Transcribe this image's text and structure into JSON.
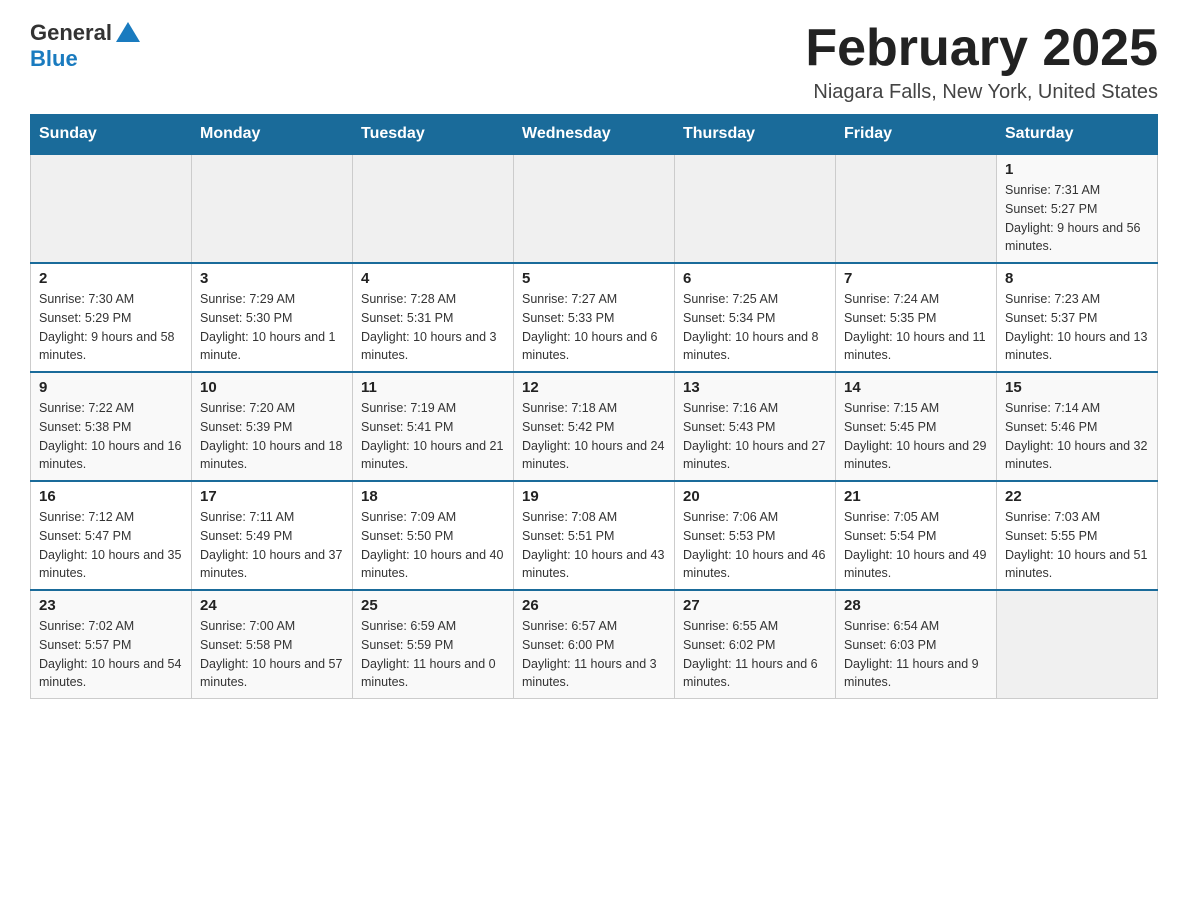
{
  "header": {
    "logo_general": "General",
    "logo_blue": "Blue",
    "month_title": "February 2025",
    "location": "Niagara Falls, New York, United States"
  },
  "days_of_week": [
    "Sunday",
    "Monday",
    "Tuesday",
    "Wednesday",
    "Thursday",
    "Friday",
    "Saturday"
  ],
  "weeks": [
    [
      {
        "day": "",
        "sunrise": "",
        "sunset": "",
        "daylight": "",
        "empty": true
      },
      {
        "day": "",
        "sunrise": "",
        "sunset": "",
        "daylight": "",
        "empty": true
      },
      {
        "day": "",
        "sunrise": "",
        "sunset": "",
        "daylight": "",
        "empty": true
      },
      {
        "day": "",
        "sunrise": "",
        "sunset": "",
        "daylight": "",
        "empty": true
      },
      {
        "day": "",
        "sunrise": "",
        "sunset": "",
        "daylight": "",
        "empty": true
      },
      {
        "day": "",
        "sunrise": "",
        "sunset": "",
        "daylight": "",
        "empty": true
      },
      {
        "day": "1",
        "sunrise": "Sunrise: 7:31 AM",
        "sunset": "Sunset: 5:27 PM",
        "daylight": "Daylight: 9 hours and 56 minutes.",
        "empty": false
      }
    ],
    [
      {
        "day": "2",
        "sunrise": "Sunrise: 7:30 AM",
        "sunset": "Sunset: 5:29 PM",
        "daylight": "Daylight: 9 hours and 58 minutes.",
        "empty": false
      },
      {
        "day": "3",
        "sunrise": "Sunrise: 7:29 AM",
        "sunset": "Sunset: 5:30 PM",
        "daylight": "Daylight: 10 hours and 1 minute.",
        "empty": false
      },
      {
        "day": "4",
        "sunrise": "Sunrise: 7:28 AM",
        "sunset": "Sunset: 5:31 PM",
        "daylight": "Daylight: 10 hours and 3 minutes.",
        "empty": false
      },
      {
        "day": "5",
        "sunrise": "Sunrise: 7:27 AM",
        "sunset": "Sunset: 5:33 PM",
        "daylight": "Daylight: 10 hours and 6 minutes.",
        "empty": false
      },
      {
        "day": "6",
        "sunrise": "Sunrise: 7:25 AM",
        "sunset": "Sunset: 5:34 PM",
        "daylight": "Daylight: 10 hours and 8 minutes.",
        "empty": false
      },
      {
        "day": "7",
        "sunrise": "Sunrise: 7:24 AM",
        "sunset": "Sunset: 5:35 PM",
        "daylight": "Daylight: 10 hours and 11 minutes.",
        "empty": false
      },
      {
        "day": "8",
        "sunrise": "Sunrise: 7:23 AM",
        "sunset": "Sunset: 5:37 PM",
        "daylight": "Daylight: 10 hours and 13 minutes.",
        "empty": false
      }
    ],
    [
      {
        "day": "9",
        "sunrise": "Sunrise: 7:22 AM",
        "sunset": "Sunset: 5:38 PM",
        "daylight": "Daylight: 10 hours and 16 minutes.",
        "empty": false
      },
      {
        "day": "10",
        "sunrise": "Sunrise: 7:20 AM",
        "sunset": "Sunset: 5:39 PM",
        "daylight": "Daylight: 10 hours and 18 minutes.",
        "empty": false
      },
      {
        "day": "11",
        "sunrise": "Sunrise: 7:19 AM",
        "sunset": "Sunset: 5:41 PM",
        "daylight": "Daylight: 10 hours and 21 minutes.",
        "empty": false
      },
      {
        "day": "12",
        "sunrise": "Sunrise: 7:18 AM",
        "sunset": "Sunset: 5:42 PM",
        "daylight": "Daylight: 10 hours and 24 minutes.",
        "empty": false
      },
      {
        "day": "13",
        "sunrise": "Sunrise: 7:16 AM",
        "sunset": "Sunset: 5:43 PM",
        "daylight": "Daylight: 10 hours and 27 minutes.",
        "empty": false
      },
      {
        "day": "14",
        "sunrise": "Sunrise: 7:15 AM",
        "sunset": "Sunset: 5:45 PM",
        "daylight": "Daylight: 10 hours and 29 minutes.",
        "empty": false
      },
      {
        "day": "15",
        "sunrise": "Sunrise: 7:14 AM",
        "sunset": "Sunset: 5:46 PM",
        "daylight": "Daylight: 10 hours and 32 minutes.",
        "empty": false
      }
    ],
    [
      {
        "day": "16",
        "sunrise": "Sunrise: 7:12 AM",
        "sunset": "Sunset: 5:47 PM",
        "daylight": "Daylight: 10 hours and 35 minutes.",
        "empty": false
      },
      {
        "day": "17",
        "sunrise": "Sunrise: 7:11 AM",
        "sunset": "Sunset: 5:49 PM",
        "daylight": "Daylight: 10 hours and 37 minutes.",
        "empty": false
      },
      {
        "day": "18",
        "sunrise": "Sunrise: 7:09 AM",
        "sunset": "Sunset: 5:50 PM",
        "daylight": "Daylight: 10 hours and 40 minutes.",
        "empty": false
      },
      {
        "day": "19",
        "sunrise": "Sunrise: 7:08 AM",
        "sunset": "Sunset: 5:51 PM",
        "daylight": "Daylight: 10 hours and 43 minutes.",
        "empty": false
      },
      {
        "day": "20",
        "sunrise": "Sunrise: 7:06 AM",
        "sunset": "Sunset: 5:53 PM",
        "daylight": "Daylight: 10 hours and 46 minutes.",
        "empty": false
      },
      {
        "day": "21",
        "sunrise": "Sunrise: 7:05 AM",
        "sunset": "Sunset: 5:54 PM",
        "daylight": "Daylight: 10 hours and 49 minutes.",
        "empty": false
      },
      {
        "day": "22",
        "sunrise": "Sunrise: 7:03 AM",
        "sunset": "Sunset: 5:55 PM",
        "daylight": "Daylight: 10 hours and 51 minutes.",
        "empty": false
      }
    ],
    [
      {
        "day": "23",
        "sunrise": "Sunrise: 7:02 AM",
        "sunset": "Sunset: 5:57 PM",
        "daylight": "Daylight: 10 hours and 54 minutes.",
        "empty": false
      },
      {
        "day": "24",
        "sunrise": "Sunrise: 7:00 AM",
        "sunset": "Sunset: 5:58 PM",
        "daylight": "Daylight: 10 hours and 57 minutes.",
        "empty": false
      },
      {
        "day": "25",
        "sunrise": "Sunrise: 6:59 AM",
        "sunset": "Sunset: 5:59 PM",
        "daylight": "Daylight: 11 hours and 0 minutes.",
        "empty": false
      },
      {
        "day": "26",
        "sunrise": "Sunrise: 6:57 AM",
        "sunset": "Sunset: 6:00 PM",
        "daylight": "Daylight: 11 hours and 3 minutes.",
        "empty": false
      },
      {
        "day": "27",
        "sunrise": "Sunrise: 6:55 AM",
        "sunset": "Sunset: 6:02 PM",
        "daylight": "Daylight: 11 hours and 6 minutes.",
        "empty": false
      },
      {
        "day": "28",
        "sunrise": "Sunrise: 6:54 AM",
        "sunset": "Sunset: 6:03 PM",
        "daylight": "Daylight: 11 hours and 9 minutes.",
        "empty": false
      },
      {
        "day": "",
        "sunrise": "",
        "sunset": "",
        "daylight": "",
        "empty": true
      }
    ]
  ]
}
